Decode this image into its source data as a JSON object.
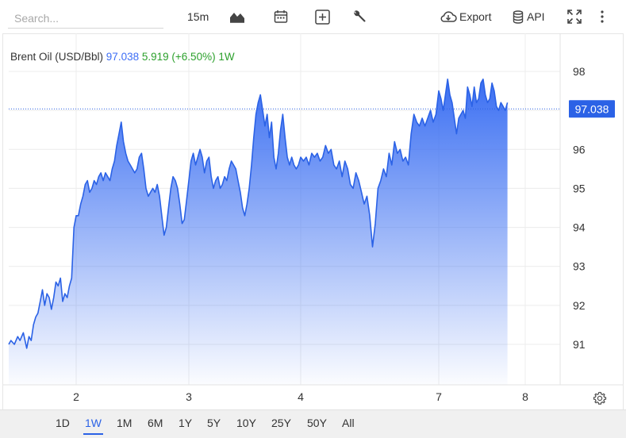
{
  "toolbar": {
    "search_placeholder": "Search...",
    "interval": "15m",
    "export_label": "Export",
    "api_label": "API"
  },
  "legend": {
    "name": "Brent Oil (USD/Bbl)",
    "price": "97.038",
    "change": "5.919",
    "change_pct": "(+6.50%)",
    "period": "1W"
  },
  "ranges": [
    "1D",
    "1W",
    "1M",
    "6M",
    "1Y",
    "5Y",
    "10Y",
    "25Y",
    "50Y",
    "All"
  ],
  "active_range": "1W",
  "colors": {
    "line": "#2b62e6",
    "fill_top": "#3b6ff2",
    "fill_bottom": "#ffffff",
    "price_label_bg": "#2b62e6",
    "positive": "#2ca02c"
  },
  "chart_data": {
    "type": "area",
    "series_name": "Brent Oil (USD/Bbl)",
    "ylim": [
      90.3,
      98.3
    ],
    "y_ticks": [
      91,
      92,
      93,
      94,
      95,
      96,
      97,
      98
    ],
    "x_ticks": [
      {
        "label": "2",
        "x": 2
      },
      {
        "label": "3",
        "x": 3
      },
      {
        "label": "4",
        "x": 4
      },
      {
        "label": "7",
        "x": 5
      },
      {
        "label": "8",
        "x": 5.78
      }
    ],
    "xlim": [
      1.4,
      6.4
    ],
    "last_price": 97.038,
    "grid": true,
    "points": [
      [
        1.4,
        91.0
      ],
      [
        1.42,
        91.1
      ],
      [
        1.45,
        91.0
      ],
      [
        1.48,
        91.2
      ],
      [
        1.5,
        91.1
      ],
      [
        1.53,
        91.3
      ],
      [
        1.56,
        90.9
      ],
      [
        1.58,
        91.2
      ],
      [
        1.6,
        91.1
      ],
      [
        1.62,
        91.5
      ],
      [
        1.64,
        91.7
      ],
      [
        1.66,
        91.8
      ],
      [
        1.68,
        92.1
      ],
      [
        1.7,
        92.4
      ],
      [
        1.72,
        92.0
      ],
      [
        1.74,
        92.3
      ],
      [
        1.76,
        92.2
      ],
      [
        1.78,
        91.9
      ],
      [
        1.8,
        92.2
      ],
      [
        1.82,
        92.6
      ],
      [
        1.84,
        92.5
      ],
      [
        1.86,
        92.7
      ],
      [
        1.88,
        92.1
      ],
      [
        1.9,
        92.3
      ],
      [
        1.92,
        92.2
      ],
      [
        1.94,
        92.5
      ],
      [
        1.96,
        92.7
      ],
      [
        1.98,
        94.0
      ],
      [
        2.0,
        94.3
      ],
      [
        2.02,
        94.3
      ],
      [
        2.04,
        94.6
      ],
      [
        2.06,
        94.8
      ],
      [
        2.08,
        95.1
      ],
      [
        2.1,
        95.2
      ],
      [
        2.12,
        94.9
      ],
      [
        2.14,
        95.0
      ],
      [
        2.16,
        95.2
      ],
      [
        2.18,
        95.1
      ],
      [
        2.2,
        95.3
      ],
      [
        2.22,
        95.4
      ],
      [
        2.24,
        95.2
      ],
      [
        2.26,
        95.4
      ],
      [
        2.28,
        95.3
      ],
      [
        2.3,
        95.2
      ],
      [
        2.32,
        95.5
      ],
      [
        2.34,
        95.7
      ],
      [
        2.36,
        96.1
      ],
      [
        2.38,
        96.4
      ],
      [
        2.4,
        96.7
      ],
      [
        2.42,
        96.2
      ],
      [
        2.44,
        95.9
      ],
      [
        2.46,
        95.7
      ],
      [
        2.48,
        95.6
      ],
      [
        2.5,
        95.5
      ],
      [
        2.52,
        95.4
      ],
      [
        2.54,
        95.5
      ],
      [
        2.56,
        95.8
      ],
      [
        2.58,
        95.9
      ],
      [
        2.6,
        95.5
      ],
      [
        2.62,
        95.0
      ],
      [
        2.64,
        94.8
      ],
      [
        2.66,
        94.9
      ],
      [
        2.68,
        95.0
      ],
      [
        2.7,
        94.9
      ],
      [
        2.72,
        95.1
      ],
      [
        2.74,
        94.8
      ],
      [
        2.76,
        94.3
      ],
      [
        2.78,
        93.8
      ],
      [
        2.8,
        94.0
      ],
      [
        2.82,
        94.5
      ],
      [
        2.84,
        95.0
      ],
      [
        2.86,
        95.3
      ],
      [
        2.88,
        95.2
      ],
      [
        2.9,
        95.0
      ],
      [
        2.92,
        94.6
      ],
      [
        2.94,
        94.1
      ],
      [
        2.96,
        94.2
      ],
      [
        2.98,
        94.7
      ],
      [
        3.0,
        95.2
      ],
      [
        3.02,
        95.7
      ],
      [
        3.04,
        95.9
      ],
      [
        3.06,
        95.6
      ],
      [
        3.08,
        95.8
      ],
      [
        3.1,
        96.0
      ],
      [
        3.12,
        95.8
      ],
      [
        3.14,
        95.4
      ],
      [
        3.16,
        95.7
      ],
      [
        3.18,
        95.8
      ],
      [
        3.2,
        95.3
      ],
      [
        3.22,
        95.0
      ],
      [
        3.24,
        95.2
      ],
      [
        3.26,
        95.3
      ],
      [
        3.28,
        95.0
      ],
      [
        3.3,
        95.1
      ],
      [
        3.32,
        95.3
      ],
      [
        3.34,
        95.2
      ],
      [
        3.36,
        95.5
      ],
      [
        3.38,
        95.7
      ],
      [
        3.4,
        95.6
      ],
      [
        3.42,
        95.5
      ],
      [
        3.44,
        95.2
      ],
      [
        3.46,
        94.9
      ],
      [
        3.48,
        94.5
      ],
      [
        3.5,
        94.3
      ],
      [
        3.52,
        94.6
      ],
      [
        3.54,
        95.0
      ],
      [
        3.56,
        95.6
      ],
      [
        3.58,
        96.3
      ],
      [
        3.6,
        96.9
      ],
      [
        3.62,
        97.2
      ],
      [
        3.64,
        97.4
      ],
      [
        3.66,
        97.0
      ],
      [
        3.68,
        96.6
      ],
      [
        3.7,
        96.9
      ],
      [
        3.72,
        96.3
      ],
      [
        3.74,
        96.7
      ],
      [
        3.76,
        95.8
      ],
      [
        3.78,
        95.5
      ],
      [
        3.8,
        95.9
      ],
      [
        3.82,
        96.5
      ],
      [
        3.84,
        96.9
      ],
      [
        3.86,
        96.3
      ],
      [
        3.88,
        95.8
      ],
      [
        3.9,
        95.6
      ],
      [
        3.92,
        95.8
      ],
      [
        3.94,
        95.6
      ],
      [
        3.96,
        95.5
      ],
      [
        3.98,
        95.6
      ],
      [
        4.0,
        95.8
      ],
      [
        4.02,
        95.7
      ],
      [
        4.04,
        95.8
      ],
      [
        4.06,
        95.6
      ],
      [
        4.08,
        95.9
      ],
      [
        4.1,
        95.8
      ],
      [
        4.12,
        95.9
      ],
      [
        4.14,
        95.7
      ],
      [
        4.16,
        95.8
      ],
      [
        4.18,
        96.1
      ],
      [
        4.2,
        95.9
      ],
      [
        4.22,
        96.0
      ],
      [
        4.24,
        95.6
      ],
      [
        4.26,
        95.5
      ],
      [
        4.28,
        95.7
      ],
      [
        4.3,
        95.3
      ],
      [
        4.32,
        95.7
      ],
      [
        4.34,
        95.5
      ],
      [
        4.36,
        95.1
      ],
      [
        4.38,
        95.0
      ],
      [
        4.4,
        95.4
      ],
      [
        4.42,
        95.2
      ],
      [
        4.44,
        94.9
      ],
      [
        4.46,
        94.6
      ],
      [
        4.48,
        94.8
      ],
      [
        4.5,
        94.3
      ],
      [
        4.52,
        93.5
      ],
      [
        4.54,
        94.1
      ],
      [
        4.56,
        95.0
      ],
      [
        4.58,
        95.2
      ],
      [
        4.6,
        95.5
      ],
      [
        4.62,
        95.3
      ],
      [
        4.64,
        95.9
      ],
      [
        4.66,
        95.6
      ],
      [
        4.68,
        96.2
      ],
      [
        4.7,
        95.9
      ],
      [
        4.72,
        96.0
      ],
      [
        4.74,
        95.7
      ],
      [
        4.76,
        95.8
      ],
      [
        4.78,
        95.6
      ],
      [
        4.8,
        96.4
      ],
      [
        4.82,
        96.9
      ],
      [
        4.84,
        96.7
      ],
      [
        4.86,
        96.6
      ],
      [
        4.88,
        96.8
      ],
      [
        4.9,
        96.6
      ],
      [
        4.92,
        96.8
      ],
      [
        4.94,
        97.0
      ],
      [
        4.96,
        96.7
      ],
      [
        4.98,
        96.9
      ],
      [
        5.0,
        97.5
      ],
      [
        5.02,
        97.3
      ],
      [
        5.04,
        97.0
      ],
      [
        5.06,
        97.4
      ],
      [
        5.08,
        97.8
      ],
      [
        5.1,
        97.4
      ],
      [
        5.12,
        97.2
      ],
      [
        5.14,
        96.8
      ],
      [
        5.16,
        96.4
      ],
      [
        5.18,
        96.8
      ],
      [
        5.2,
        96.9
      ],
      [
        5.22,
        97.0
      ],
      [
        5.24,
        96.8
      ],
      [
        5.26,
        97.6
      ],
      [
        5.28,
        97.4
      ],
      [
        5.3,
        97.1
      ],
      [
        5.32,
        97.6
      ],
      [
        5.34,
        97.2
      ],
      [
        5.36,
        97.3
      ],
      [
        5.38,
        97.7
      ],
      [
        5.4,
        97.8
      ],
      [
        5.42,
        97.4
      ],
      [
        5.44,
        97.2
      ],
      [
        5.46,
        97.3
      ],
      [
        5.48,
        97.7
      ],
      [
        5.5,
        97.5
      ],
      [
        5.52,
        97.1
      ],
      [
        5.54,
        97.0
      ],
      [
        5.56,
        97.2
      ],
      [
        5.58,
        97.1
      ],
      [
        5.6,
        97.0
      ],
      [
        5.62,
        97.2
      ]
    ]
  }
}
